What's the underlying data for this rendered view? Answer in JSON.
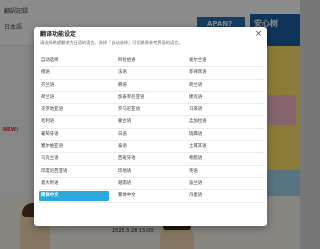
{
  "background": {
    "title": "翻訳記録",
    "subtitle": "日本語",
    "japan_banner": "APAN?",
    "sns_banner": "安心树",
    "new_badge": "NEW!",
    "date_text": "2025.5.28 15:00"
  },
  "modal": {
    "title": "翻译功能设定",
    "description": "请选择希望翻译为日语的语言。选择「自动选择」可切换原参考界面的语言。",
    "close_symbol": "×",
    "selected_language": "简体中文",
    "languages": [
      [
        "自动选择",
        "阿拉伯语",
        "爱尔兰语"
      ],
      [
        "俄语",
        "法语",
        "菲律宾语"
      ],
      [
        "芬兰语",
        "韩语",
        "荷兰语"
      ],
      [
        "荷兰语",
        "加泰罗尼亚语",
        "捷克语"
      ],
      [
        "克罗地亚语",
        "罗马尼亚语",
        "马来语"
      ],
      [
        "毛利语",
        "蒙古语",
        "孟加拉语"
      ],
      [
        "葡萄牙语",
        "日语",
        "瑞典语"
      ],
      [
        "塞尔维亚语",
        "泰语",
        "土耳其语"
      ],
      [
        "乌克兰语",
        "西班牙语",
        "希腊语"
      ],
      [
        "印度尼西亚语",
        "印地语",
        "英语"
      ],
      [
        "意大利语",
        "越南语",
        "波兰语"
      ],
      [
        "简体中文",
        "繁体中文",
        "丹麦语"
      ]
    ]
  }
}
